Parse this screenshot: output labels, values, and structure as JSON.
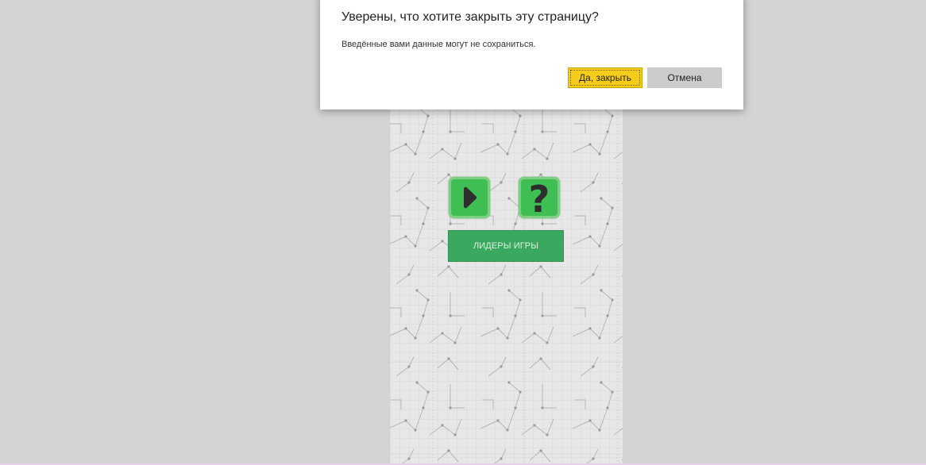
{
  "dialog": {
    "title": "Уверены, что хотите закрыть эту страницу?",
    "message": "Введённые вами данные могут не сохраниться.",
    "confirm_label": "Да, закрыть",
    "cancel_label": "Отмена"
  },
  "game": {
    "play_icon": "play-icon",
    "help_icon": "question-mark-icon",
    "help_glyph": "?",
    "leaders_label": "ЛИДЕРЫ ИГРЫ",
    "colors": {
      "button_green": "#3fbe54",
      "button_border": "#7dcf82",
      "leaders_green": "#3aa85e",
      "confirm_yellow": "#f5cd1a",
      "cancel_gray": "#cccccc",
      "backdrop": "#d4d4d4"
    }
  }
}
